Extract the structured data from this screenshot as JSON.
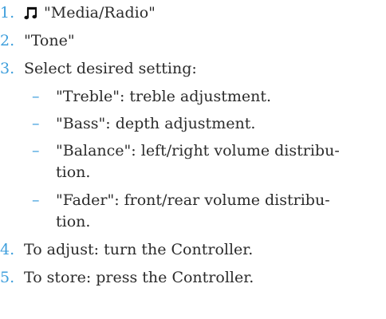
{
  "steps": [
    {
      "number": "1.",
      "icon": "music-note-icon",
      "text": "\"Media/Radio\""
    },
    {
      "number": "2.",
      "text": "\"Tone\""
    },
    {
      "number": "3.",
      "text": "Select desired setting:"
    },
    {
      "number": "4.",
      "text": "To adjust: turn the Controller."
    },
    {
      "number": "5.",
      "text": "To store: press the Controller."
    }
  ],
  "settings": [
    {
      "dash": "–",
      "text": "\"Treble\": treble adjustment."
    },
    {
      "dash": "–",
      "text": "\"Bass\": depth adjustment."
    },
    {
      "dash": "–",
      "lines": [
        "\"Balance\": left/right volume distribu-",
        "tion."
      ]
    },
    {
      "dash": "–",
      "lines": [
        "\"Fader\": front/rear volume distribu-",
        "tion."
      ]
    }
  ],
  "colors": {
    "step_number": "#3f9fdc",
    "dash": "#3f9fdc",
    "text": "#2b2b2b",
    "background": "#ffffff"
  }
}
